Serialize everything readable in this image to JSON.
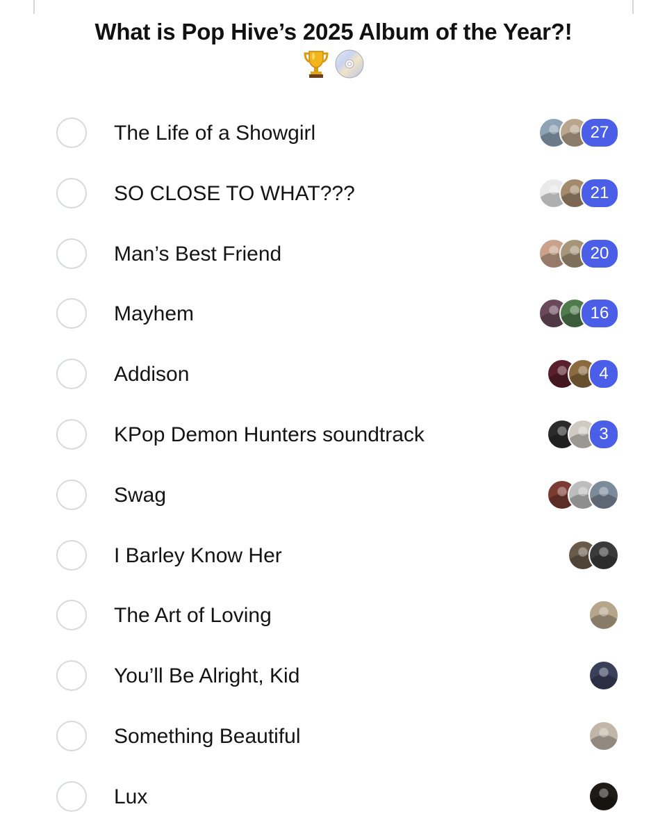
{
  "poll": {
    "title": "What is Pop Hive’s 2025 Album of the Year?!",
    "title_icons": [
      "trophy-icon",
      "disc-icon"
    ],
    "accent_color": "#4a5ee8",
    "options": [
      {
        "label": "The Life of a Showgirl",
        "votes": "27",
        "avatars": [
          "#8fa3b6",
          "#b8a58c"
        ]
      },
      {
        "label": "SO CLOSE TO WHAT???",
        "votes": "21",
        "avatars": [
          "#e9e9ea",
          "#a48a6c"
        ]
      },
      {
        "label": "Man’s Best Friend",
        "votes": "20",
        "avatars": [
          "#c9a28b",
          "#a89478"
        ]
      },
      {
        "label": "Mayhem",
        "votes": "16",
        "avatars": [
          "#6a4a5a",
          "#4f7a4c"
        ]
      },
      {
        "label": "Addison",
        "votes": "4",
        "avatars": [
          "#5a1f2a",
          "#8a6a3e"
        ]
      },
      {
        "label": "KPop Demon Hunters soundtrack",
        "votes": "3",
        "avatars": [
          "#2a2a2a",
          "#cfcac2"
        ]
      },
      {
        "label": "Swag",
        "votes": "",
        "avatars": [
          "#7a3b32",
          "#bdbdbd",
          "#7c8a9a"
        ]
      },
      {
        "label": "I Barley Know Her",
        "votes": "",
        "avatars": [
          "#6a5a4a",
          "#3a3a3a"
        ]
      },
      {
        "label": "The Art of Loving",
        "votes": "",
        "avatars": [
          "#b5a58a"
        ]
      },
      {
        "label": "You’ll Be Alright, Kid",
        "votes": "",
        "avatars": [
          "#3a3f5a"
        ]
      },
      {
        "label": "Something Beautiful",
        "votes": "",
        "avatars": [
          "#c2b6a8"
        ]
      },
      {
        "label": "Lux",
        "votes": "",
        "avatars": [
          "#1e1a16"
        ]
      }
    ]
  }
}
